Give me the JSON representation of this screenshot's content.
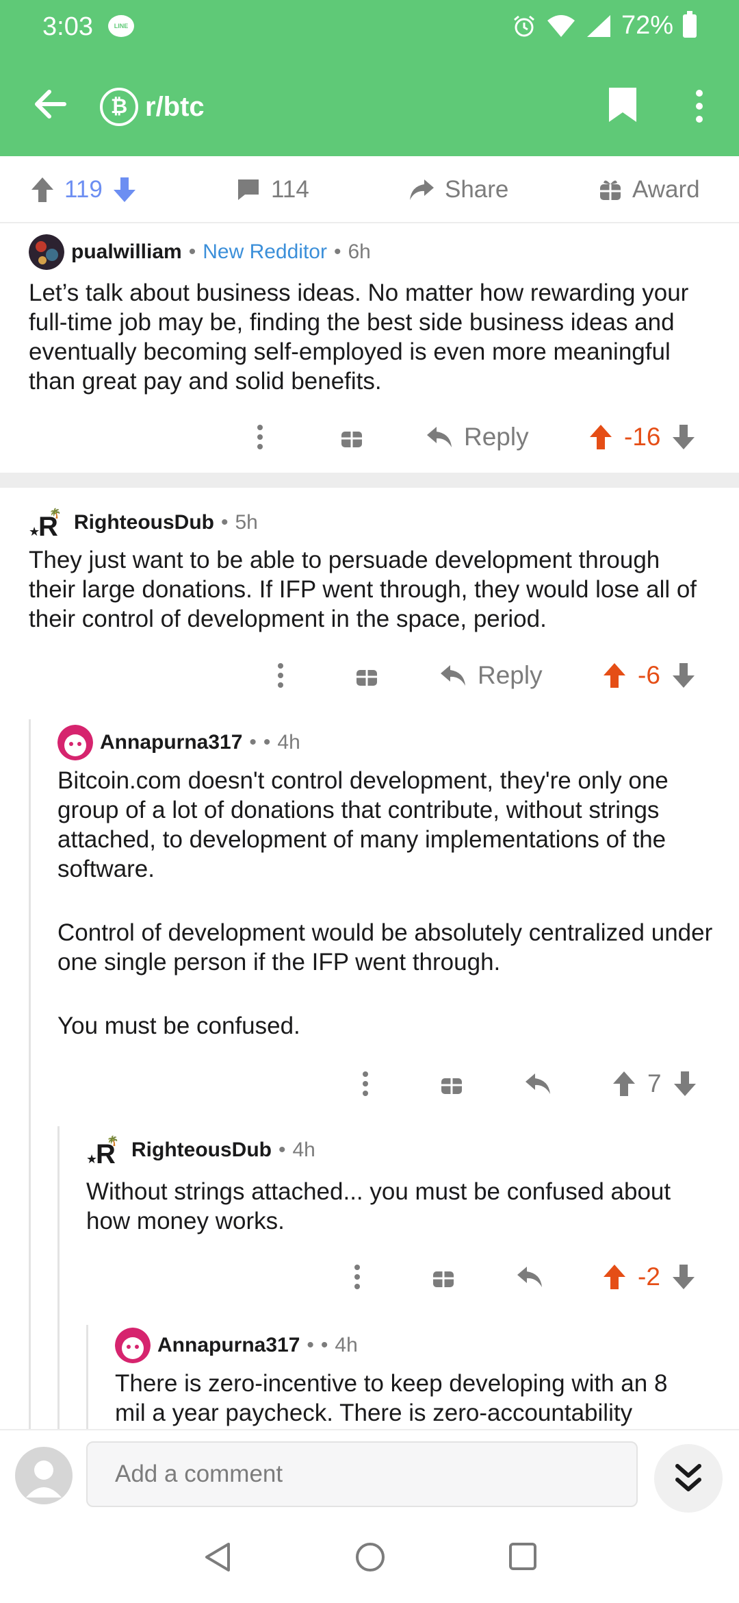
{
  "status_bar": {
    "time": "3:03",
    "line_label": "LINE",
    "battery": "72%"
  },
  "app_bar": {
    "subreddit": "r/btc",
    "subreddit_icon_glyph": "₿"
  },
  "post_actions": {
    "upvotes": "119",
    "comments": "114",
    "share": "Share",
    "award": "Award"
  },
  "comments": [
    {
      "user": "pualwilliam",
      "flair": "New Redditor",
      "age": "6h",
      "body": [
        "Let’s talk about business ideas. No matter how rewarding your full-time job may be, finding the best side business ideas and eventually becoming self-employed is even more meaningful than great pay and solid benefits."
      ],
      "reply_label": "Reply",
      "score": "-16"
    },
    {
      "user": "RighteousDub",
      "age": "5h",
      "body": [
        "They just want to be able to persuade development through their large donations. If IFP went through, they would lose all of their control of development in the space, period."
      ],
      "reply_label": "Reply",
      "score": "-6"
    },
    {
      "user": "Annapurna317",
      "age": "4h",
      "body": [
        "Bitcoin.com doesn't control development, they're only one group of a lot of donations that contribute, without strings attached, to development of many implementations of the software.",
        "Control of development would be absolutely centralized under one single person if the IFP went through.",
        "You must be confused."
      ],
      "score": "7"
    },
    {
      "user": "RighteousDub",
      "age": "4h",
      "body": [
        "Without strings attached... you must be confused about how money works."
      ],
      "score": "-2"
    },
    {
      "user": "Annapurna317",
      "age": "4h",
      "body": [
        "There is zero-incentive to keep developing with an 8 mil a year paycheck. There is zero-accountability"
      ]
    }
  ],
  "bottom_bar": {
    "placeholder": "Add a comment"
  },
  "colors": {
    "accent": "#5fc977",
    "upvote": "#6c8ef2",
    "downvoted_score": "#e54e16",
    "flair": "#3b8fd9"
  },
  "icons": [
    "back-arrow-icon",
    "bitcoin-icon",
    "bookmark-icon",
    "more-vertical-icon",
    "upvote-icon",
    "downvote-icon",
    "comment-icon",
    "share-icon",
    "award-icon",
    "reply-icon",
    "chevron-double-down-icon",
    "nav-back-icon",
    "nav-home-icon",
    "nav-recents-icon"
  ]
}
